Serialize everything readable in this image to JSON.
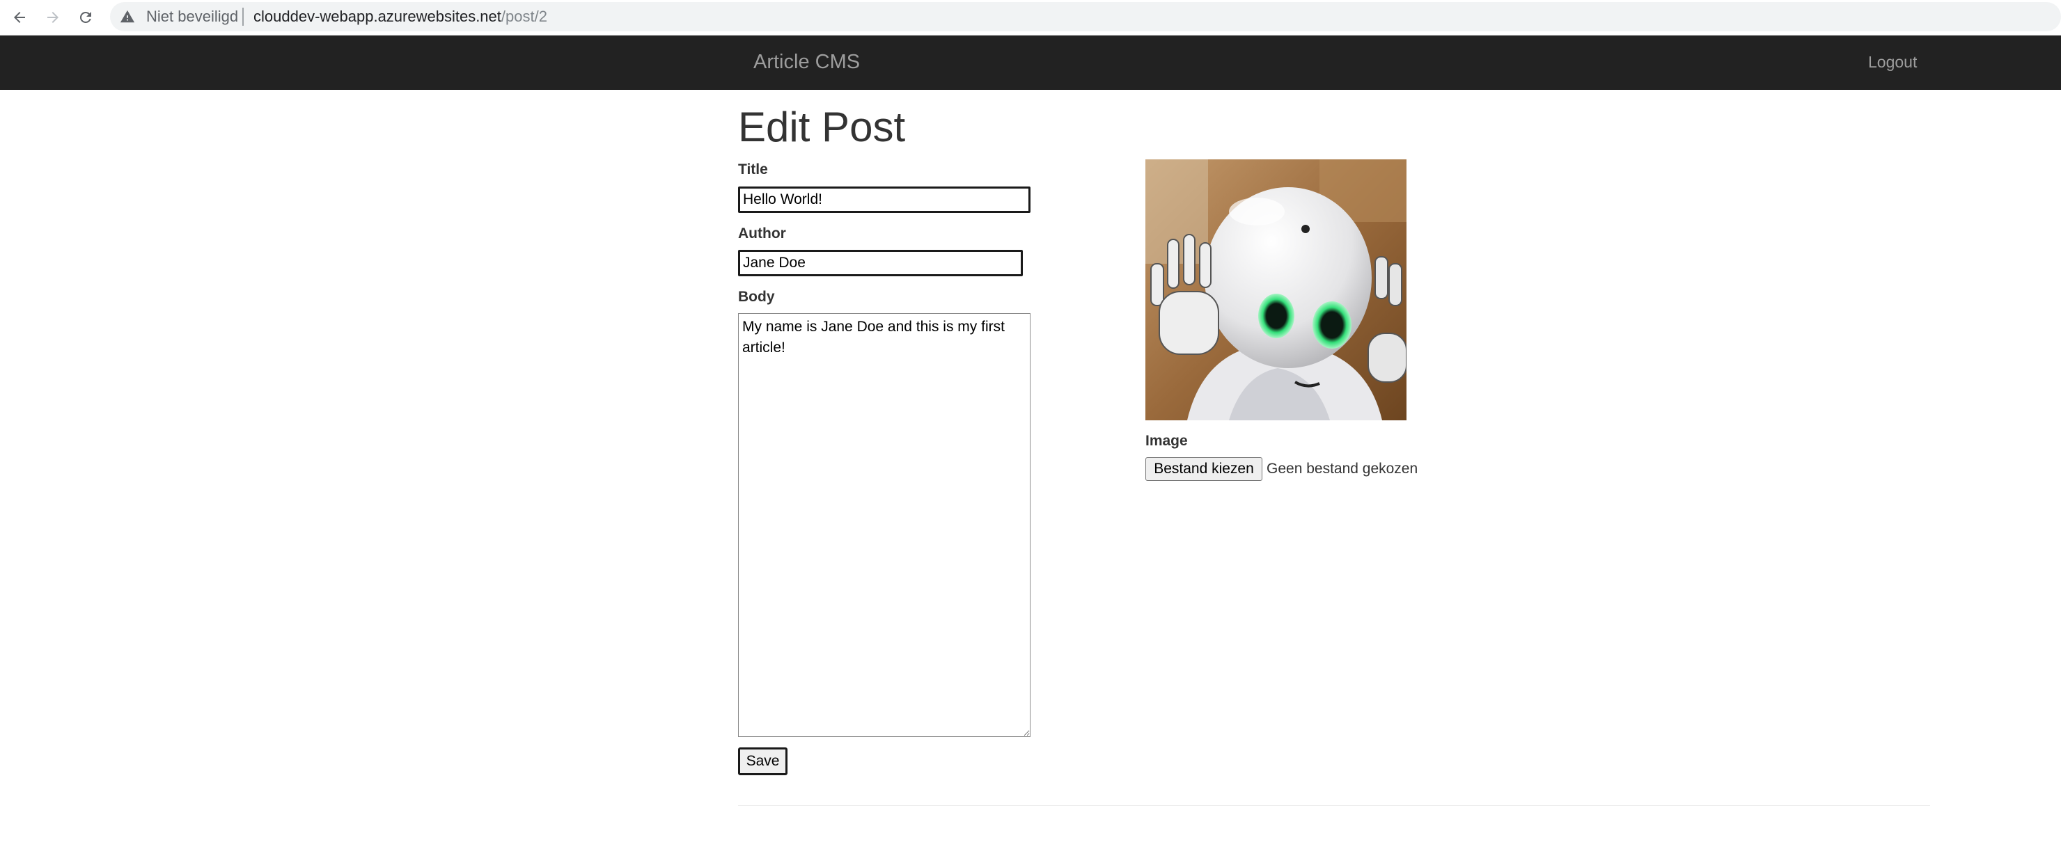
{
  "browser": {
    "security_label": "Niet beveiligd",
    "url_host": "clouddev-webapp.azurewebsites.net",
    "url_path": "/post/2"
  },
  "navbar": {
    "brand": "Article CMS",
    "logout_label": "Logout"
  },
  "page": {
    "title": "Edit Post"
  },
  "form": {
    "title_label": "Title",
    "title_value": "Hello World!",
    "author_label": "Author",
    "author_value": "Jane Doe",
    "body_label": "Body",
    "body_value": "My name is Jane Doe and this is my first article!",
    "save_label": "Save",
    "image_label": "Image",
    "choose_file_label": "Bestand kiezen",
    "no_file_text": "Geen bestand gekozen"
  },
  "icons": {
    "back": "arrow-left-icon",
    "forward": "arrow-right-icon",
    "reload": "reload-icon",
    "security": "warning-triangle-icon"
  },
  "colors": {
    "navbar_bg": "#222222",
    "navbar_text": "#9d9d9d",
    "page_text": "#333333"
  }
}
